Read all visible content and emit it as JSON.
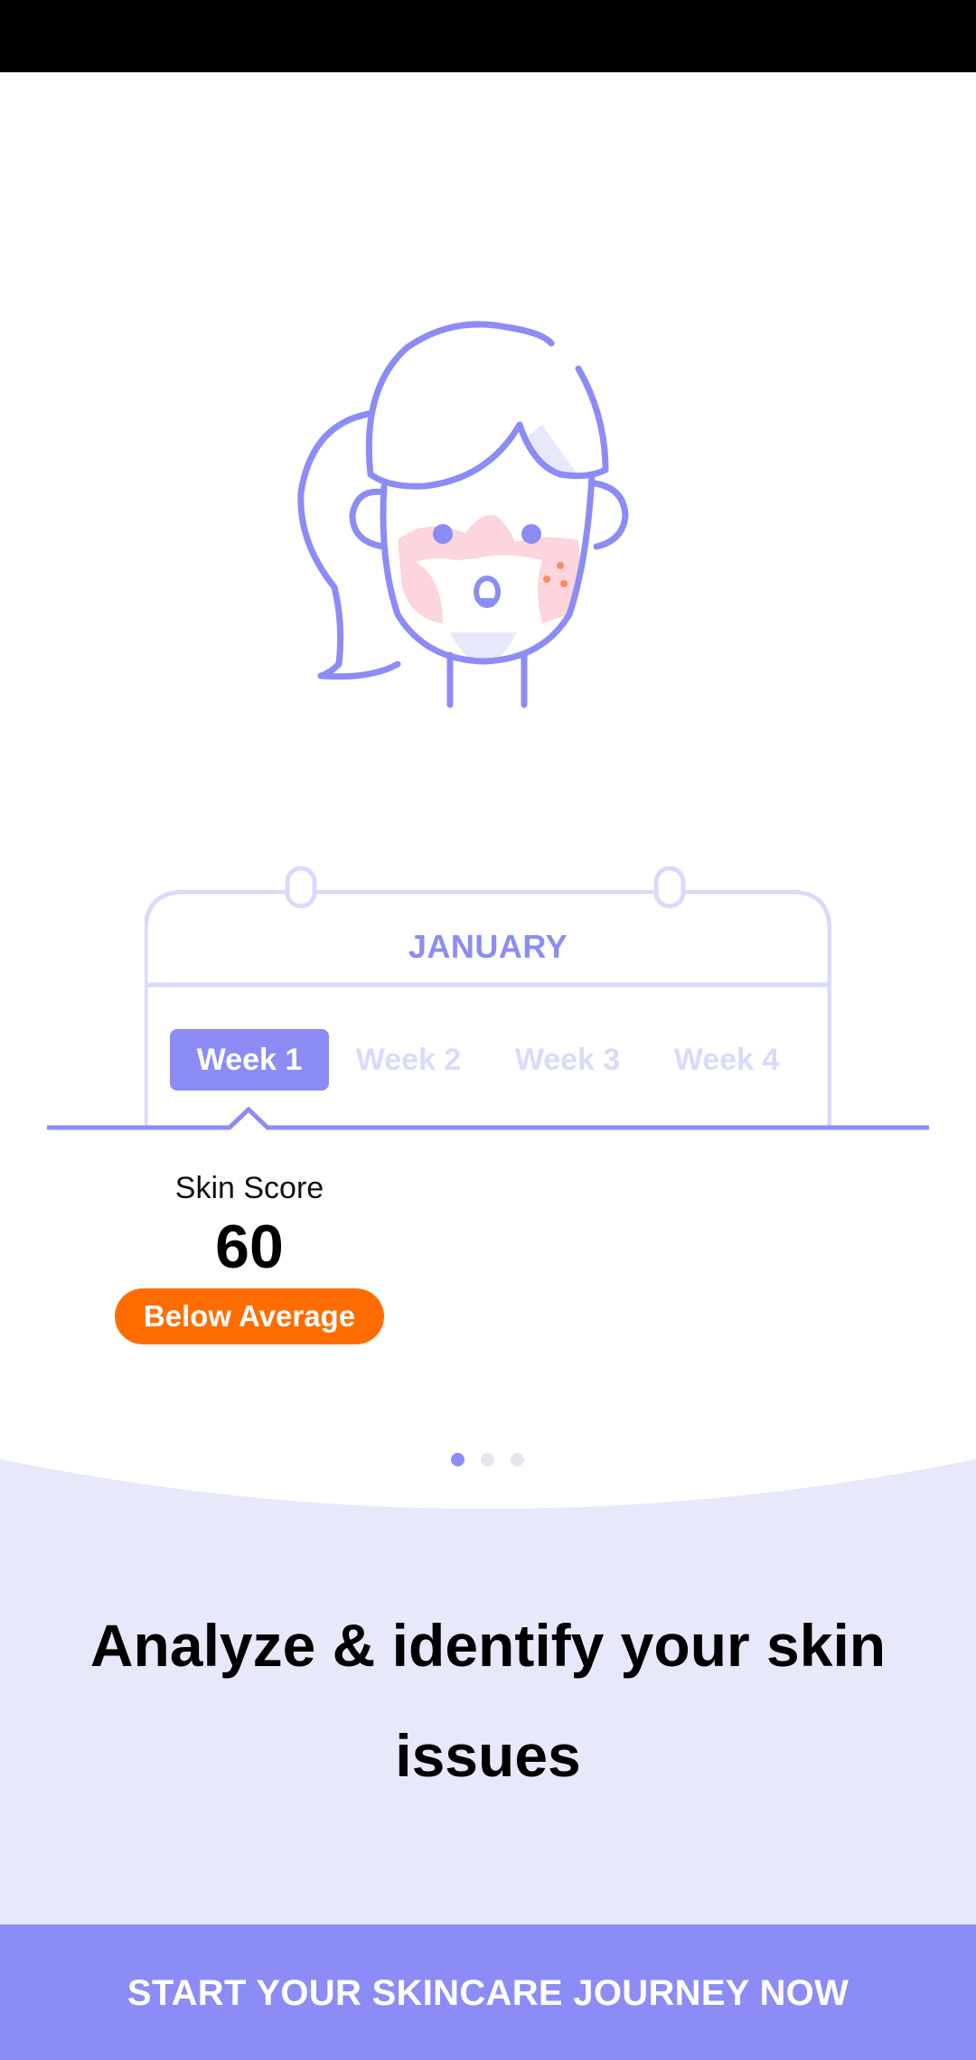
{
  "colors": {
    "accent": "#8b8cf5",
    "accent_light": "#d9dafc",
    "accent_pale": "#e8e8fb",
    "blush": "#fdd5dc",
    "freckle": "#f98a6a",
    "badge_orange": "#ff6d00",
    "inactive_dot": "#e6e6ec"
  },
  "illustration": {
    "icon": "girl-face-illustration-icon"
  },
  "calendar": {
    "month": "JANUARY",
    "weeks": [
      "Week 1",
      "Week 2",
      "Week 3",
      "Week 4"
    ],
    "selected_week_index": 0
  },
  "skin_score": {
    "label": "Skin Score",
    "value": "60",
    "rating": "Below Average"
  },
  "pager": {
    "count": 3,
    "active_index": 0
  },
  "onboarding": {
    "headline_line1": "Analyze & identify your skin",
    "headline_line2": "issues"
  },
  "cta": {
    "label": "START YOUR SKINCARE JOURNEY NOW"
  }
}
